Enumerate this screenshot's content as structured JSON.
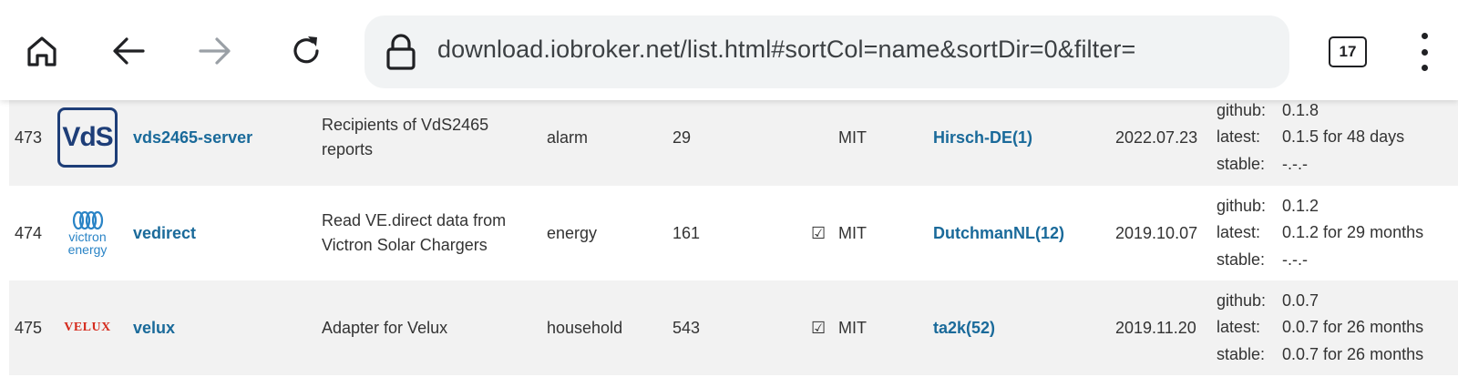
{
  "browser": {
    "url": "download.iobroker.net/list.html#sortCol=name&sortDir=0&filter=",
    "tab_count": "17",
    "icons": [
      "home-icon",
      "back-arrow-icon",
      "forward-arrow-icon",
      "reload-icon",
      "lock-icon",
      "tabs-icon",
      "more-vert-icon"
    ]
  },
  "rows": [
    {
      "index": "473",
      "logo": "VdS",
      "name": "vds2465-server",
      "desc_line1": "Recipients of VdS2465",
      "desc_line2": "reports",
      "type": "alarm",
      "installs": "29",
      "check": "",
      "license": "MIT",
      "author": "Hirsch-DE(1)",
      "date": "2022.07.23",
      "versions": {
        "github_label": "github:",
        "github": "0.1.8",
        "latest_label": "latest:",
        "latest": "0.1.5 for 48 days",
        "stable_label": "stable:",
        "stable": "-.-.-"
      }
    },
    {
      "index": "474",
      "logo_line1": "victron",
      "logo_line2": "energy",
      "name": "vedirect",
      "desc_line1": "Read VE.direct data from",
      "desc_line2": "Victron Solar Chargers",
      "type": "energy",
      "installs": "161",
      "check": "☑",
      "license": "MIT",
      "author": "DutchmanNL(12)",
      "date": "2019.10.07",
      "versions": {
        "github_label": "github:",
        "github": "0.1.2",
        "latest_label": "latest:",
        "latest": "0.1.2 for 29 months",
        "stable_label": "stable:",
        "stable": "-.-.-"
      }
    },
    {
      "index": "475",
      "logo": "VELUX",
      "name": "velux",
      "desc_line1": "Adapter for Velux",
      "desc_line2": "",
      "type": "household",
      "installs": "543",
      "check": "☑",
      "license": "MIT",
      "author": "ta2k(52)",
      "date": "2019.11.20",
      "versions": {
        "github_label": "github:",
        "github": "0.0.7",
        "latest_label": "latest:",
        "latest": "0.0.7 for 26 months",
        "stable_label": "stable:",
        "stable": "0.0.7 for 26 months"
      }
    }
  ],
  "colors": {
    "link": "#1a6a9a",
    "row_alt": "#f2f2f2",
    "vds_blue": "#1e3e78",
    "victron_blue": "#2a84c6",
    "velux_red": "#d52b1e"
  }
}
